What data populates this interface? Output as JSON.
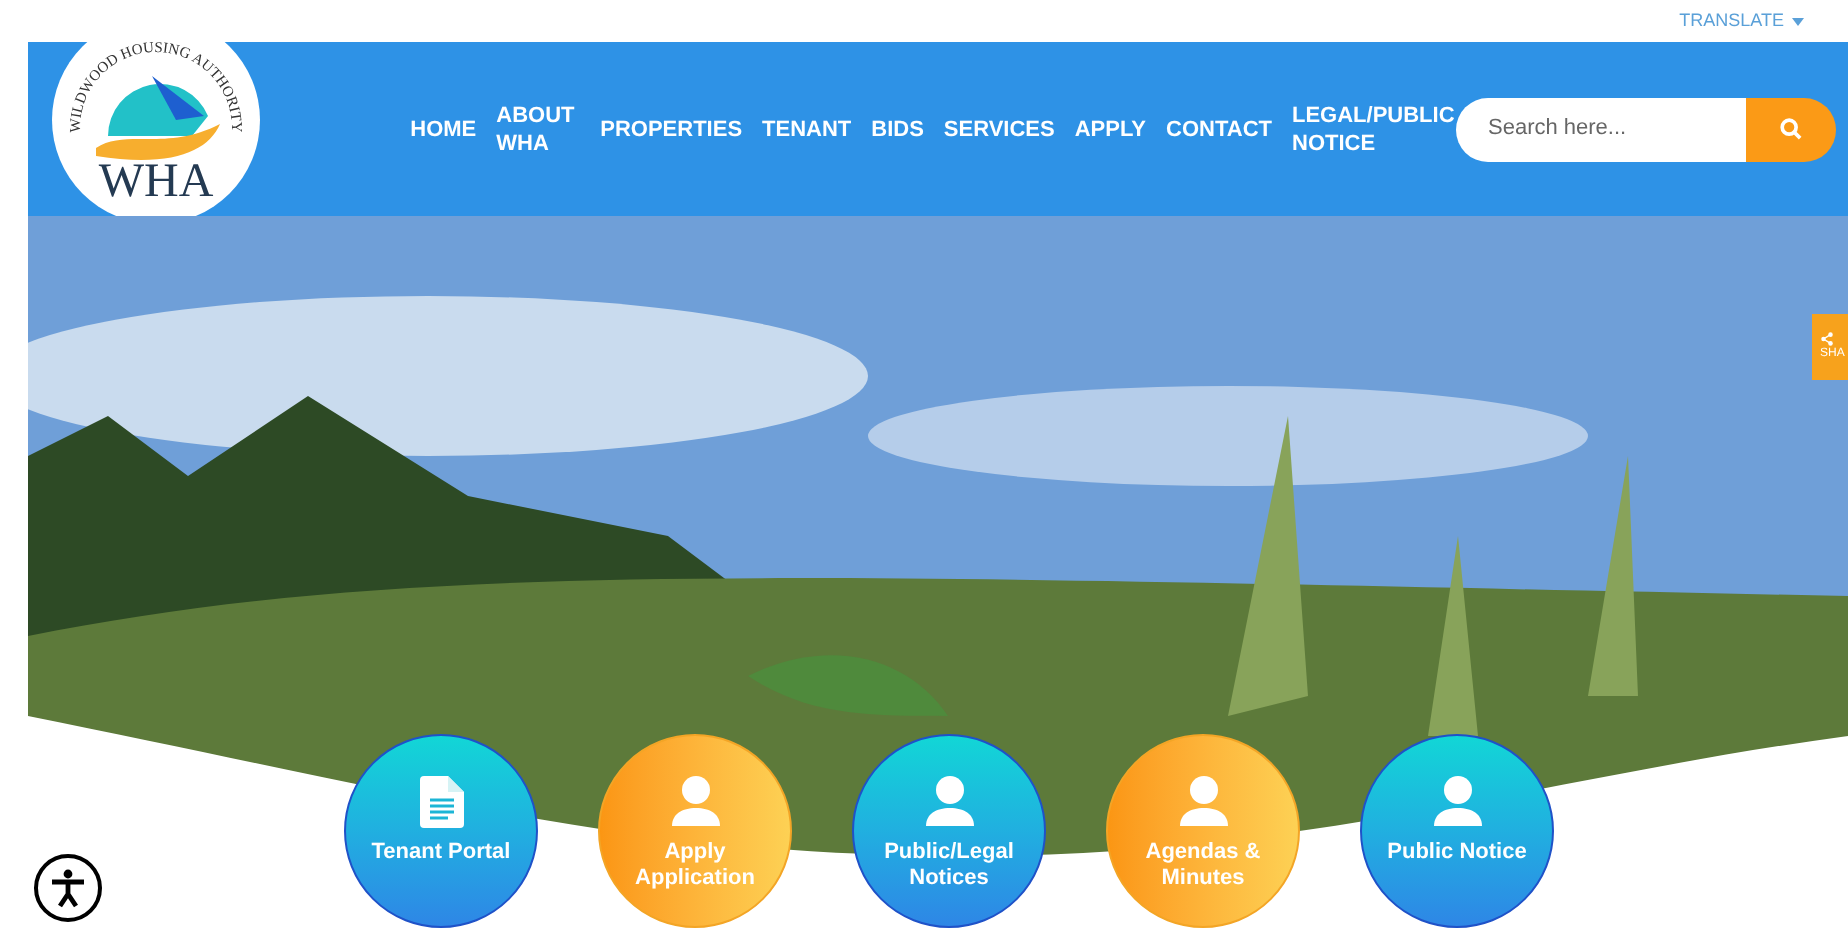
{
  "top_bar": {
    "translate": "TRANSLATE"
  },
  "logo": {
    "arc_text": "WILDWOOD HOUSING AUTHORITY",
    "initials": "WHA"
  },
  "nav": [
    {
      "label": "HOME"
    },
    {
      "label": "ABOUT WHA"
    },
    {
      "label": "PROPERTIES"
    },
    {
      "label": "TENANT"
    },
    {
      "label": "BIDS"
    },
    {
      "label": "SERVICES"
    },
    {
      "label": "APPLY"
    },
    {
      "label": "CONTACT"
    },
    {
      "label": "LEGAL/PUBLIC NOTICE"
    }
  ],
  "search": {
    "placeholder": "Search here..."
  },
  "share_tab": {
    "label": "SHA"
  },
  "quick_links": [
    {
      "label": "Tenant Portal",
      "kind": "blue"
    },
    {
      "label": "Apply Application",
      "kind": "orange"
    },
    {
      "label": "Public/Legal Notices",
      "kind": "blue"
    },
    {
      "label": "Agendas & Minutes",
      "kind": "orange"
    },
    {
      "label": "Public Notice",
      "kind": "blue"
    }
  ]
}
